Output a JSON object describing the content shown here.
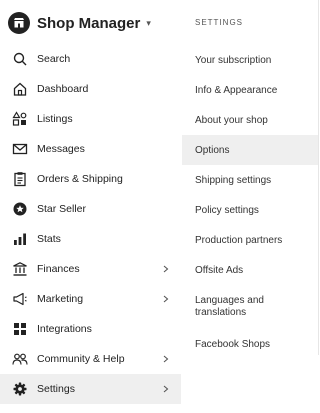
{
  "brand": {
    "title": "Shop Manager",
    "caret": "▾",
    "icon": "shop-icon"
  },
  "nav": [
    {
      "label": "Search",
      "icon": "search-icon",
      "chevron": false
    },
    {
      "label": "Dashboard",
      "icon": "home-icon",
      "chevron": false
    },
    {
      "label": "Listings",
      "icon": "shapes-icon",
      "chevron": false
    },
    {
      "label": "Messages",
      "icon": "envelope-icon",
      "chevron": false
    },
    {
      "label": "Orders & Shipping",
      "icon": "clipboard-icon",
      "chevron": false
    },
    {
      "label": "Star Seller",
      "icon": "star-badge-icon",
      "chevron": false
    },
    {
      "label": "Stats",
      "icon": "bar-chart-icon",
      "chevron": false
    },
    {
      "label": "Finances",
      "icon": "bank-icon",
      "chevron": true
    },
    {
      "label": "Marketing",
      "icon": "megaphone-icon",
      "chevron": true
    },
    {
      "label": "Integrations",
      "icon": "grid-icon",
      "chevron": false
    },
    {
      "label": "Community & Help",
      "icon": "people-icon",
      "chevron": true
    },
    {
      "label": "Settings",
      "icon": "gear-icon",
      "chevron": true,
      "active": true
    }
  ],
  "chevron": "›",
  "settings": {
    "section_title": "SETTINGS",
    "items": [
      {
        "label": "Your subscription"
      },
      {
        "label": "Info & Appearance"
      },
      {
        "label": "About your shop"
      },
      {
        "label": "Options",
        "active": true
      },
      {
        "label": "Shipping settings"
      },
      {
        "label": "Policy settings"
      },
      {
        "label": "Production partners"
      },
      {
        "label": "Offsite Ads"
      },
      {
        "label": "Languages and translations"
      },
      {
        "label": "Facebook Shops"
      }
    ]
  },
  "colors": {
    "text": "#222222",
    "muted": "#555555",
    "active_bg": "#efefef"
  }
}
